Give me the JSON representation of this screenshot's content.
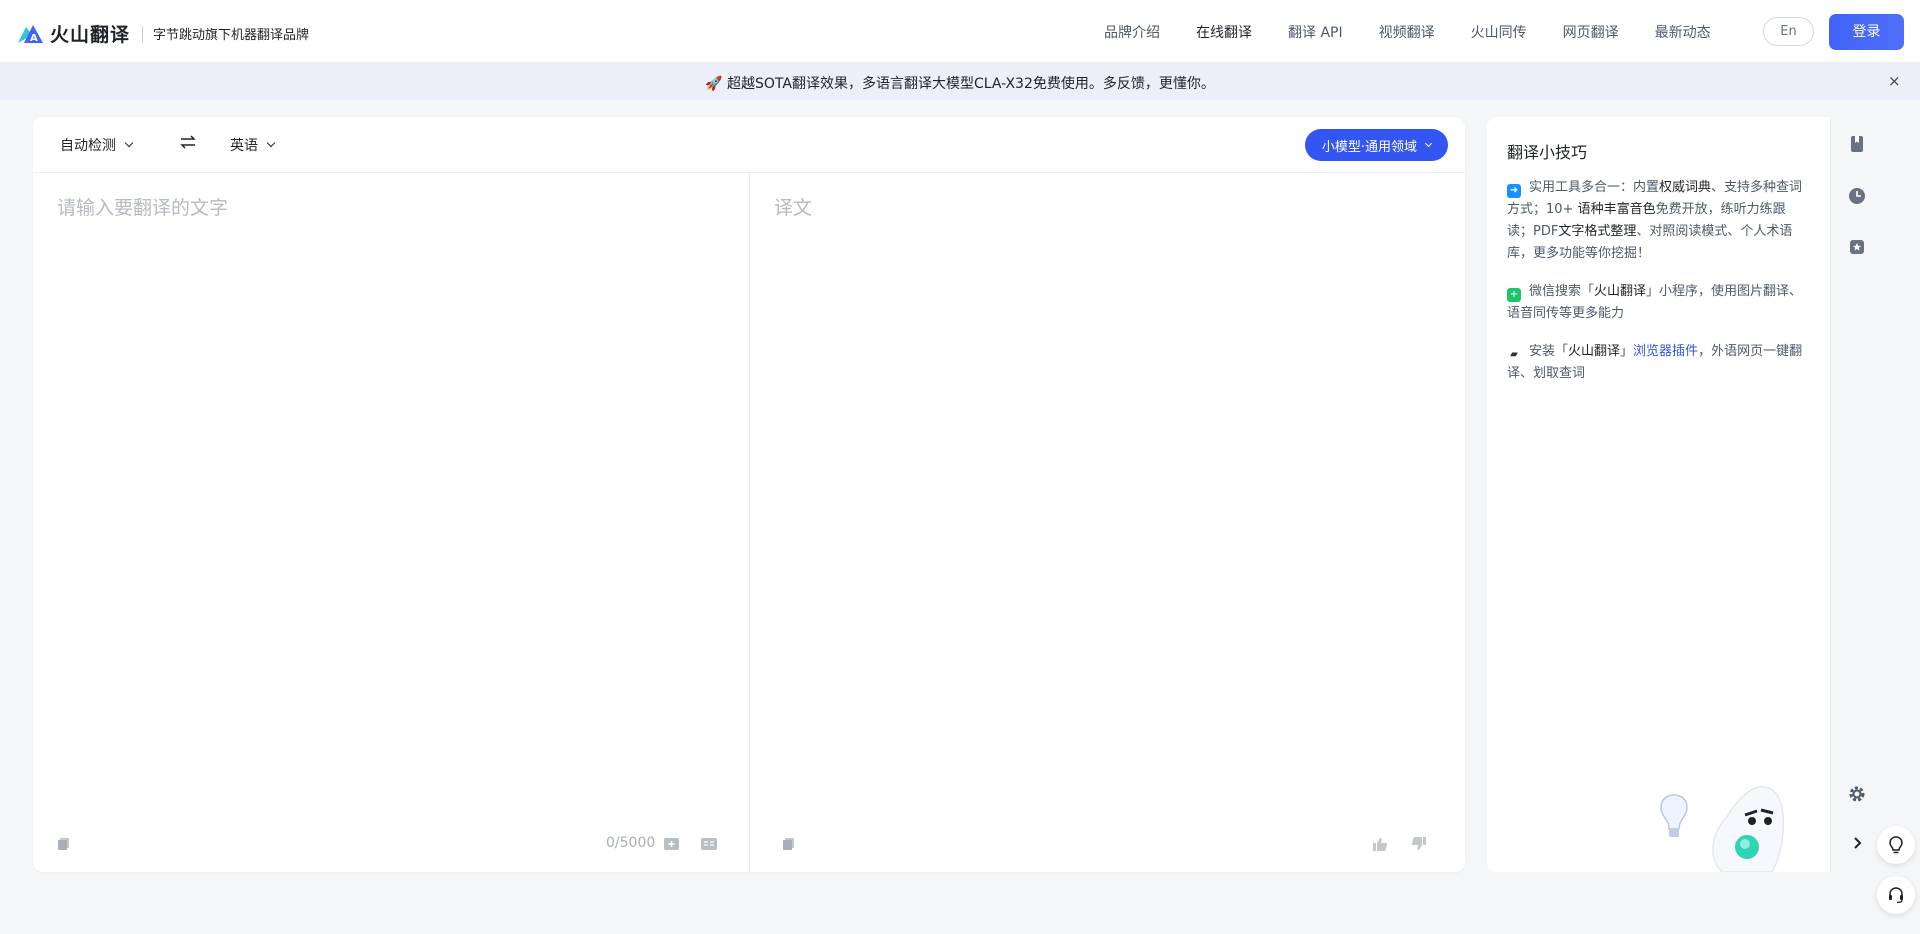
{
  "header": {
    "brand": "火山翻译",
    "tagline": "字节跳动旗下机器翻译品牌",
    "nav": [
      {
        "label": "品牌介绍",
        "active": false
      },
      {
        "label": "在线翻译",
        "active": true
      },
      {
        "label": "翻译 API",
        "active": false
      },
      {
        "label": "视频翻译",
        "active": false
      },
      {
        "label": "火山同传",
        "active": false
      },
      {
        "label": "网页翻译",
        "active": false
      },
      {
        "label": "最新动态",
        "active": false
      }
    ],
    "lang_toggle": "En",
    "login": "登录"
  },
  "banner": {
    "icon": "rocket-icon",
    "text": "🚀 超越SOTA翻译效果，多语言翻译大模型CLA-X32免费使用。多反馈，更懂你。",
    "close": "×"
  },
  "translator": {
    "source_lang": "自动检测",
    "target_lang": "英语",
    "model": "小模型·通用领域",
    "source_placeholder": "请输入要翻译的文字",
    "target_placeholder": "译文",
    "char_count": "0/5000"
  },
  "tips": {
    "title": "翻译小技巧",
    "items": [
      {
        "pre": "实用工具多合一：内置",
        "b1": "权威词典",
        "mid1": "、支持多种查词方式；10+ ",
        "b2": "语种丰富音色",
        "mid2": "免费开放，练听力练跟读；PDF",
        "b3": "文字格式整理",
        "post": "、对照阅读模式、个人术语库，更多功能等你挖掘！"
      },
      {
        "pre": "微信搜索「",
        "b1": "火山翻译",
        "post": "」小程序，使用图片翻译、语音同传等更多能力"
      },
      {
        "pre": "安装「",
        "b1": "火山翻译",
        "mid": "」",
        "link": "浏览器插件",
        "post": "，外语网页一键翻译、划取查词"
      }
    ]
  },
  "colors": {
    "accent": "#3356f3",
    "banner_bg": "#eceef8",
    "page_bg": "#f5f6f8"
  }
}
